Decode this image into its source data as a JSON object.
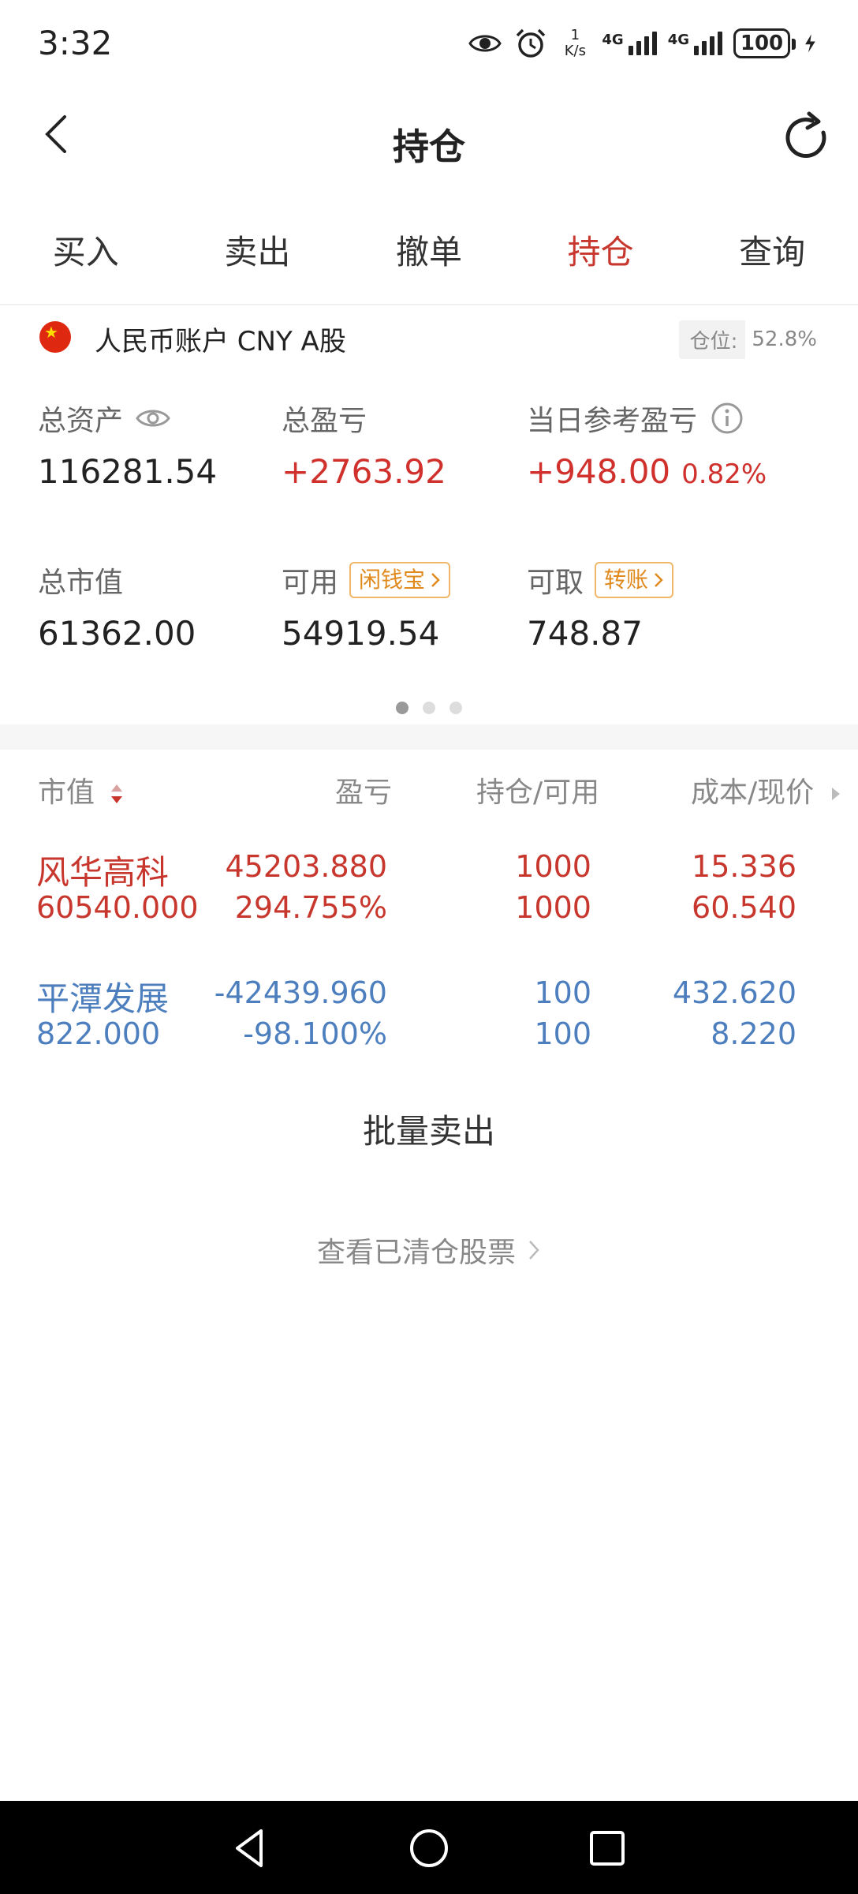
{
  "status_bar": {
    "time": "3:32",
    "net_speed_value": "1",
    "net_speed_unit": "K/s",
    "signal_1": "4G",
    "signal_2": "4G",
    "battery": "100",
    "icons": [
      "eye-icon",
      "alarm-icon",
      "charging-icon"
    ]
  },
  "header": {
    "title": "持仓",
    "back_icon": "chevron-left-icon",
    "refresh_icon": "refresh-icon"
  },
  "tabs": [
    {
      "label": "买入",
      "active": false
    },
    {
      "label": "卖出",
      "active": false
    },
    {
      "label": "撤单",
      "active": false
    },
    {
      "label": "持仓",
      "active": true
    },
    {
      "label": "查询",
      "active": false
    }
  ],
  "account": {
    "flag_icon": "china-flag-icon",
    "name": "人民币账户 CNY A股",
    "position_label": "仓位:",
    "position_value": "52.8%"
  },
  "summary": {
    "total_assets_label": "总资产",
    "total_assets": "116281.54",
    "total_pnl_label": "总盈亏",
    "total_pnl": "+2763.92",
    "daily_pnl_label": "当日参考盈亏",
    "daily_pnl": "+948.00",
    "daily_pnl_pct": "0.82%",
    "market_value_label": "总市值",
    "market_value": "61362.00",
    "available_label": "可用",
    "available": "54919.54",
    "available_tag": "闲钱宝",
    "withdrawable_label": "可取",
    "withdrawable": "748.87",
    "withdrawable_tag": "转账"
  },
  "pager": {
    "count": 3,
    "active": 0
  },
  "table": {
    "headers": {
      "market_value": "市值",
      "pnl": "盈亏",
      "holding": "持仓/可用",
      "cost": "成本/现价"
    },
    "rows": [
      {
        "name": "风华高科",
        "market_value": "60540.000",
        "pnl": "45203.880",
        "pnl_pct": "294.755%",
        "holding": "1000",
        "available": "1000",
        "cost": "15.336",
        "price": "60.540",
        "color": "#c8372d"
      },
      {
        "name": "平潭发展",
        "market_value": "822.000",
        "pnl": "-42439.960",
        "pnl_pct": "-98.100%",
        "holding": "100",
        "available": "100",
        "cost": "432.620",
        "price": "8.220",
        "color": "#4d7fbf"
      }
    ]
  },
  "actions": {
    "batch_sell": "批量卖出",
    "view_cleared": "查看已清仓股票"
  },
  "colors": {
    "accent_red": "#c8372d",
    "loss_blue": "#4d7fbf",
    "tag_orange": "#e08a1e"
  }
}
